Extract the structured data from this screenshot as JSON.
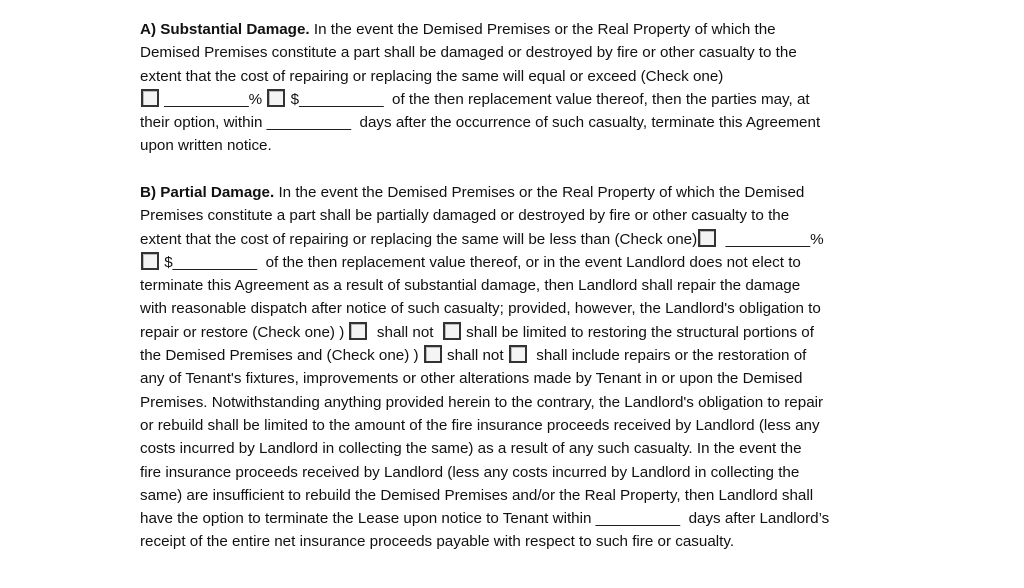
{
  "section_a": {
    "lines": [
      [
        {
          "b": "A) Substantial Damage."
        },
        {
          "t": " In the event the Demised Premises or the Real Property of which the"
        }
      ],
      [
        {
          "t": "Demised Premises constitute a part shall be damaged or destroyed by fire or other casualty to the"
        }
      ],
      [
        {
          "t": "extent that the cost of repairing or replacing the same will equal or exceed (Check one)"
        }
      ],
      [
        {
          "cb": "percent-option-checkbox"
        },
        {
          "t": " __________% "
        },
        {
          "cb": "dollar-option-checkbox"
        },
        {
          "t": " $__________  of the then replacement value thereof, then the parties may, at"
        }
      ],
      [
        {
          "t": "their option, within __________  days after the occurrence of such casualty, terminate this Agreement"
        }
      ],
      [
        {
          "t": "upon written notice."
        }
      ]
    ]
  },
  "section_b": {
    "lines": [
      [
        {
          "b": "B) Partial Damage."
        },
        {
          "t": " In the event the Demised Premises or the Real Property of which the Demised"
        }
      ],
      [
        {
          "t": "Premises constitute a part shall be partially damaged or destroyed by fire or other casualty to the"
        }
      ],
      [
        {
          "t": "extent that the cost of repairing or replacing the same will be less than (Check one)"
        },
        {
          "cb": "percent-option-checkbox"
        },
        {
          "t": "  __________%"
        }
      ],
      [
        {
          "cb": "dollar-option-checkbox"
        },
        {
          "t": " $__________  of the then replacement value thereof, or in the event Landlord does not elect to"
        }
      ],
      [
        {
          "t": "terminate this Agreement as a result of substantial damage, then Landlord shall repair the damage"
        }
      ],
      [
        {
          "t": "with reasonable dispatch after notice of such casualty; provided, however, the Landlord's obligation to"
        }
      ],
      [
        {
          "t": "repair or restore (Check one) ) "
        },
        {
          "cb": "shall-not-checkbox"
        },
        {
          "t": "  shall not  "
        },
        {
          "cb": "shall-be-limited-checkbox"
        },
        {
          "t": " shall be limited to restoring the structural portions of"
        }
      ],
      [
        {
          "t": "the Demised Premises and (Check one) ) "
        },
        {
          "cb": "shall-not-checkbox"
        },
        {
          "t": " shall not "
        },
        {
          "cb": "shall-include-checkbox"
        },
        {
          "t": "  shall include repairs or the restoration of"
        }
      ],
      [
        {
          "t": "any of Tenant's fixtures, improvements or other alterations made by Tenant in or upon the Demised"
        }
      ],
      [
        {
          "t": "Premises. Notwithstanding anything provided herein to the contrary, the Landlord's obligation to repair"
        }
      ],
      [
        {
          "t": "or rebuild shall be limited to the amount of the fire insurance proceeds received by Landlord (less any"
        }
      ],
      [
        {
          "t": "costs incurred by Landlord in collecting the same) as a result of any such casualty. In the event the"
        }
      ],
      [
        {
          "t": "fire insurance proceeds received by Landlord (less any costs incurred by Landlord in collecting the"
        }
      ],
      [
        {
          "t": "same) are insufficient to rebuild the Demised Premises and/or the Real Property, then Landlord shall"
        }
      ],
      [
        {
          "t": "have the option to terminate the Lease upon notice to Tenant within __________  days after Landlord’s"
        }
      ],
      [
        {
          "t": "receipt of the entire net insurance proceeds payable with respect to such fire or casualty."
        }
      ]
    ]
  }
}
